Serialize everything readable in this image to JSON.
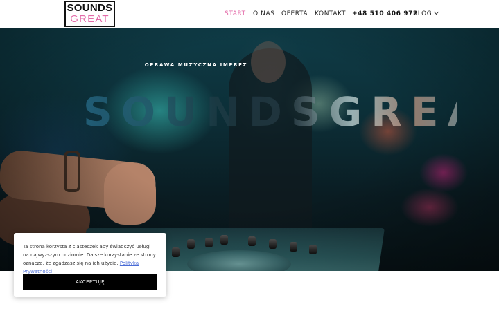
{
  "brand": {
    "logo_line1": "SOUNDS",
    "logo_line2": "GREAT",
    "accent_color": "#e36aa8"
  },
  "nav": {
    "items": [
      {
        "label": "START",
        "active": true
      },
      {
        "label": "O NAS"
      },
      {
        "label": "OFERTA"
      },
      {
        "label": "KONTAKT"
      },
      {
        "label": "+48 510 406 972"
      },
      {
        "label": "BLOG",
        "has_dropdown": true,
        "icon": "chevron-down-icon"
      }
    ]
  },
  "hero": {
    "subtitle": "OPRAWA MUZYCZNA IMPREZ",
    "title": "SOUNDSGREAT"
  },
  "cookie": {
    "text": "Ta strona korzysta z ciasteczek aby świadczyć usługi na najwyższym poziomie. Dalsze korzystanie ze strony oznacza, że zgadzasz się na ich użycie.",
    "link_label": "Polityka Prywatności",
    "accept_label": "AKCEPTUJĘ"
  }
}
